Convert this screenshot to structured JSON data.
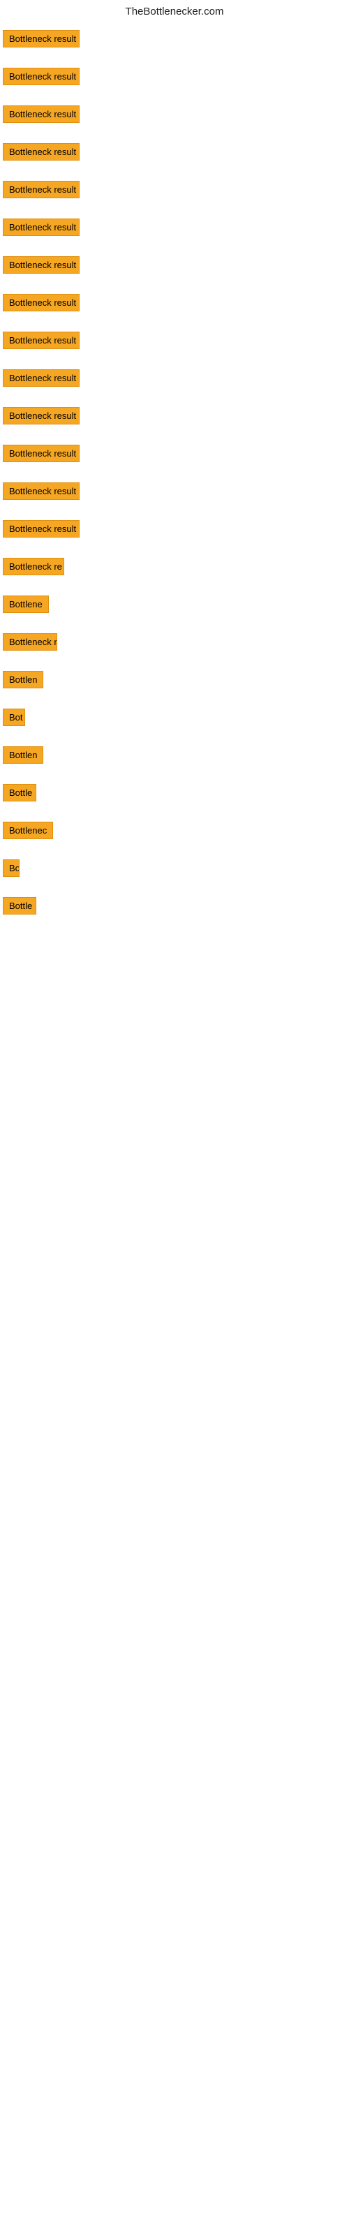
{
  "header": {
    "title": "TheBottlenecker.com"
  },
  "items": [
    {
      "id": 1,
      "label": "Bottleneck result",
      "width": 110
    },
    {
      "id": 2,
      "label": "Bottleneck result",
      "width": 110
    },
    {
      "id": 3,
      "label": "Bottleneck result",
      "width": 110
    },
    {
      "id": 4,
      "label": "Bottleneck result",
      "width": 110
    },
    {
      "id": 5,
      "label": "Bottleneck result",
      "width": 110
    },
    {
      "id": 6,
      "label": "Bottleneck result",
      "width": 110
    },
    {
      "id": 7,
      "label": "Bottleneck result",
      "width": 110
    },
    {
      "id": 8,
      "label": "Bottleneck result",
      "width": 110
    },
    {
      "id": 9,
      "label": "Bottleneck result",
      "width": 110
    },
    {
      "id": 10,
      "label": "Bottleneck result",
      "width": 110
    },
    {
      "id": 11,
      "label": "Bottleneck result",
      "width": 110
    },
    {
      "id": 12,
      "label": "Bottleneck result",
      "width": 110
    },
    {
      "id": 13,
      "label": "Bottleneck result",
      "width": 110
    },
    {
      "id": 14,
      "label": "Bottleneck result",
      "width": 110
    },
    {
      "id": 15,
      "label": "Bottleneck re",
      "width": 88
    },
    {
      "id": 16,
      "label": "Bottlene",
      "width": 68
    },
    {
      "id": 17,
      "label": "Bottleneck r",
      "width": 78
    },
    {
      "id": 18,
      "label": "Bottlen",
      "width": 58
    },
    {
      "id": 19,
      "label": "Bot",
      "width": 32
    },
    {
      "id": 20,
      "label": "Bottlen",
      "width": 58
    },
    {
      "id": 21,
      "label": "Bottle",
      "width": 48
    },
    {
      "id": 22,
      "label": "Bottlenec",
      "width": 72
    },
    {
      "id": 23,
      "label": "Bo",
      "width": 24
    },
    {
      "id": 24,
      "label": "Bottle",
      "width": 48
    }
  ]
}
